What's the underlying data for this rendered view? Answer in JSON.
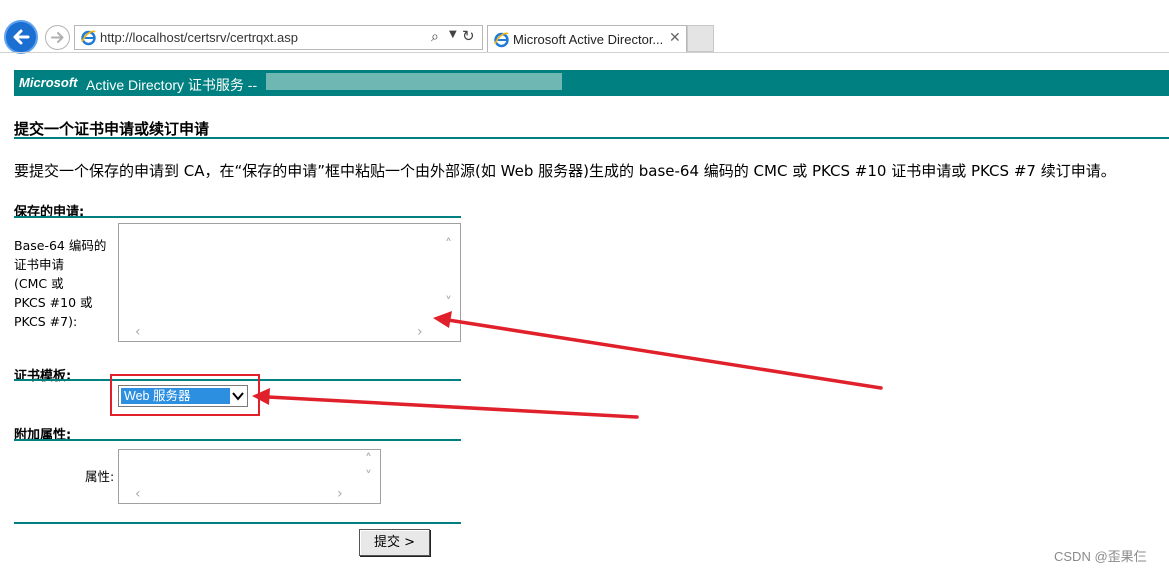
{
  "browser": {
    "url": "http://localhost/certsrv/certrqxt.asp",
    "tab_title": "Microsoft Active Director...",
    "icons": [
      "back-icon",
      "forward-icon",
      "ie-icon",
      "search-icon",
      "dropdown-icon",
      "refresh-icon",
      "close-icon"
    ]
  },
  "banner": {
    "brand": "Microsoft",
    "title": "Active Directory 证书服务  --"
  },
  "page": {
    "title": "提交一个证书申请或续订申请",
    "description": "要提交一个保存的申请到 CA，在“保存的申请”框中粘贴一个由外部源(如 Web 服务器)生成的 base-64 编码的 CMC 或 PKCS #10 证书申请或 PKCS #7 续订申请。"
  },
  "saved_request": {
    "section_label": "保存的申请:",
    "field_label_lines": [
      "Base-64 编码的",
      "证书申请",
      "(CMC 或",
      "PKCS #10 或",
      "PKCS #7):"
    ],
    "value": ""
  },
  "template": {
    "section_label": "证书模板:",
    "selected": "Web 服务器"
  },
  "attributes": {
    "section_label": "附加属性:",
    "field_label": "属性:",
    "value": ""
  },
  "submit_label": "提交 >",
  "watermark": "CSDN @歪果仨",
  "colors": {
    "teal": "#008080",
    "annotation_red": "#e0202a",
    "selection_blue": "#2d8fe0"
  }
}
